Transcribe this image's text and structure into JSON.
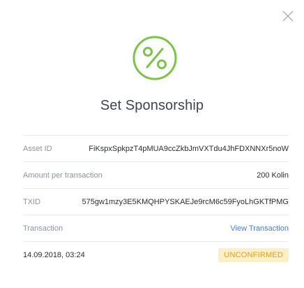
{
  "dialog": {
    "title": "Set Sponsorship",
    "close_icon": "close-icon",
    "header_icon": "percent-icon",
    "accent_color": "#7cc34a"
  },
  "details": [
    {
      "label": "Asset ID",
      "value": "FiKspxSpkpzT4pMUA9ccZkbJmVXTdu4JhFDXNNXr5noW"
    },
    {
      "label": "Amount per transaction",
      "value": "200 Kolin"
    },
    {
      "label": "TXID",
      "value": "575gw1mzy3E5KMQHPYSKAEJe9rcM6c59FyoLhGKTfPMG"
    },
    {
      "label": "Transaction",
      "value": "View Transaction"
    }
  ],
  "status": {
    "date": "14.09.2018, 03:24",
    "badge": "UNCONFIRMED",
    "badge_bg": "#fbefc8",
    "badge_color": "#e0a020"
  }
}
